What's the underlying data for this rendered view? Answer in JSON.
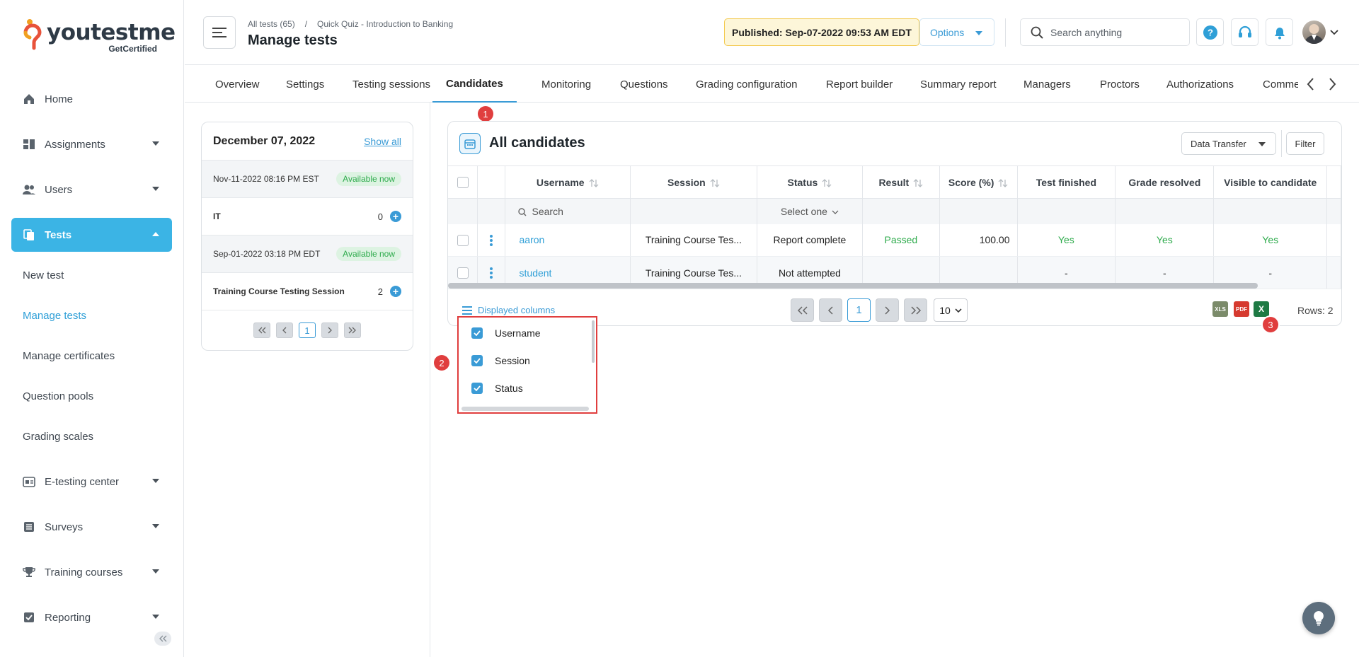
{
  "brand": {
    "word_you": "you",
    "word_test": "test",
    "word_me": "me",
    "sub": "GetCertified"
  },
  "colors": {
    "accent": "#3bb4e5",
    "link": "#2f9fd7",
    "success": "#2eab4c",
    "annotation": "#e03e3e",
    "published_bg": "#fdf6d9"
  },
  "sidebar": {
    "items": [
      {
        "label": "Home",
        "icon": "home-icon"
      },
      {
        "label": "Assignments",
        "icon": "assignments-icon"
      },
      {
        "label": "Users",
        "icon": "users-icon"
      },
      {
        "label": "Tests",
        "icon": "tests-icon"
      },
      {
        "label": "E-testing center",
        "icon": "etesting-icon"
      },
      {
        "label": "Surveys",
        "icon": "surveys-icon"
      },
      {
        "label": "Training courses",
        "icon": "trophy-icon"
      },
      {
        "label": "Reporting",
        "icon": "reporting-icon"
      }
    ],
    "subitems": [
      "New test",
      "Manage tests",
      "Manage certificates",
      "Question pools",
      "Grading scales"
    ]
  },
  "header": {
    "breadcrumb": [
      "All tests (65)",
      "/",
      "Quick Quiz - Introduction to Banking"
    ],
    "title": "Manage tests",
    "published": "Published: Sep-07-2022 09:53 AM EDT",
    "options": "Options",
    "search_placeholder": "Search anything"
  },
  "tabs": [
    "Overview",
    "Settings",
    "Testing sessions",
    "Candidates",
    "Monitoring",
    "Questions",
    "Grading configuration",
    "Report builder",
    "Summary report",
    "Managers",
    "Proctors",
    "Authorizations",
    "Comme"
  ],
  "annotations": [
    "1",
    "2",
    "3"
  ],
  "sessions": {
    "date_title": "December 07, 2022",
    "show_all": "Show all",
    "groups": [
      {
        "date": "Nov-11-2022 08:16 PM EST",
        "status": "Available now",
        "name": "IT",
        "count": "0"
      },
      {
        "date": "Sep-01-2022 03:18 PM EDT",
        "status": "Available now",
        "name": "Training Course Testing Session",
        "count": "2"
      }
    ],
    "page": "1"
  },
  "candidates": {
    "title": "All candidates",
    "data_transfer": "Data Transfer",
    "filter": "Filter",
    "columns": [
      "Username",
      "Session",
      "Status",
      "Result",
      "Score (%)",
      "Test finished",
      "Grade resolved",
      "Visible to candidate"
    ],
    "filter_search_placeholder": "Search",
    "filter_status": "Select one",
    "rows": [
      {
        "username": "aaron",
        "session": "Training Course Tes...",
        "status": "Report complete",
        "result": "Passed",
        "score": "100.00",
        "finished": "Yes",
        "resolved": "Yes",
        "visible": "Yes"
      },
      {
        "username": "student",
        "session": "Training Course Tes...",
        "status": "Not attempted",
        "result": "",
        "score": "",
        "finished": "-",
        "resolved": "-",
        "visible": "-"
      }
    ],
    "displayed_columns": "Displayed columns",
    "page": "1",
    "per_page": "10",
    "rows_label": "Rows: 2",
    "export": {
      "xls": "XLS",
      "pdf": "PDF",
      "excel": "X"
    }
  },
  "column_chooser": [
    "Username",
    "Session",
    "Status"
  ]
}
